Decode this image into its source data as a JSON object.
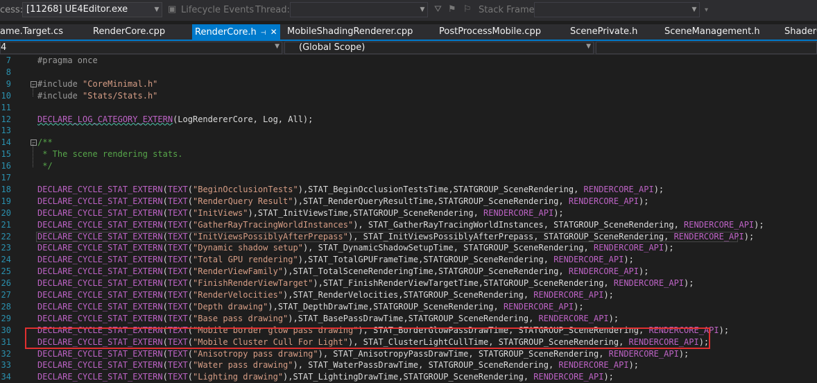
{
  "toolbar": {
    "process_label": "cess:",
    "process_value": "[11268] UE4Editor.exe",
    "lifecycle_label": "Lifecycle Events",
    "thread_label": "Thread:",
    "stack_frame_label": "Stack Frame:"
  },
  "tabs": [
    {
      "label": "ame.Target.cs",
      "active": false
    },
    {
      "label": "RenderCore.cpp",
      "active": false
    },
    {
      "label": "RenderCore.h",
      "active": true
    },
    {
      "label": "MobileShadingRenderer.cpp",
      "active": false
    },
    {
      "label": "PostProcessMobile.cpp",
      "active": false
    },
    {
      "label": "ScenePrivate.h",
      "active": false
    },
    {
      "label": "SceneManagement.h",
      "active": false
    },
    {
      "label": "ShaderC",
      "active": false
    }
  ],
  "navbar": {
    "project": "4",
    "scope": "(Global Scope)"
  },
  "colors": {
    "accent": "#007acc",
    "highlight_box": "#e03030",
    "line_number": "#2b91af",
    "string": "#d69d85",
    "macro": "#bd63c5",
    "comment": "#57a64a",
    "preprocessor": "#9b9b9b"
  },
  "code_lines": [
    {
      "n": "7",
      "tokens": [
        [
          "pre",
          "#pragma once"
        ]
      ]
    },
    {
      "n": "8",
      "tokens": []
    },
    {
      "n": "9",
      "fold": true,
      "tokens": [
        [
          "pre",
          "#include "
        ],
        [
          "str",
          "\"CoreMinimal.h\""
        ]
      ]
    },
    {
      "n": "10",
      "tokens": [
        [
          "pre",
          "#include "
        ],
        [
          "str",
          "\"Stats/Stats.h\""
        ]
      ]
    },
    {
      "n": "11",
      "tokens": []
    },
    {
      "n": "12",
      "tokens": [
        [
          "mac",
          "DECLARE_LOG_CATEGORY_EXTERN"
        ],
        [
          "txt",
          "(LogRendererCore, Log, All);"
        ]
      ]
    },
    {
      "n": "13",
      "tokens": []
    },
    {
      "n": "14",
      "fold": true,
      "tokens": [
        [
          "cmt",
          "/**"
        ]
      ]
    },
    {
      "n": "15",
      "tokens": [
        [
          "cmt",
          " * The scene rendering stats."
        ]
      ]
    },
    {
      "n": "16",
      "tokens": [
        [
          "cmt",
          " */"
        ]
      ]
    },
    {
      "n": "17",
      "tokens": []
    },
    {
      "n": "18",
      "tokens": [
        [
          "mac",
          "DECLARE_CYCLE_STAT_EXTERN"
        ],
        [
          "txt",
          "("
        ],
        [
          "mac",
          "TEXT"
        ],
        [
          "txt",
          "("
        ],
        [
          "str",
          "\"BeginOcclusionTests\""
        ],
        [
          "txt",
          "),STAT_BeginOcclusionTestsTime,STATGROUP_SceneRendering, "
        ],
        [
          "mac",
          "RENDERCORE_API"
        ],
        [
          "txt",
          ");"
        ]
      ]
    },
    {
      "n": "19",
      "tokens": [
        [
          "mac",
          "DECLARE_CYCLE_STAT_EXTERN"
        ],
        [
          "txt",
          "("
        ],
        [
          "mac",
          "TEXT"
        ],
        [
          "txt",
          "("
        ],
        [
          "str",
          "\"RenderQuery Result\""
        ],
        [
          "txt",
          "),STAT_RenderQueryResultTime,STATGROUP_SceneRendering, "
        ],
        [
          "mac",
          "RENDERCORE_API"
        ],
        [
          "txt",
          ");"
        ]
      ]
    },
    {
      "n": "20",
      "tokens": [
        [
          "mac",
          "DECLARE_CYCLE_STAT_EXTERN"
        ],
        [
          "txt",
          "("
        ],
        [
          "mac",
          "TEXT"
        ],
        [
          "txt",
          "("
        ],
        [
          "str",
          "\"InitViews\""
        ],
        [
          "txt",
          "),STAT_InitViewsTime,STATGROUP_SceneRendering, "
        ],
        [
          "mac",
          "RENDERCORE_API"
        ],
        [
          "txt",
          ");"
        ]
      ]
    },
    {
      "n": "21",
      "tokens": [
        [
          "mac",
          "DECLARE_CYCLE_STAT_EXTERN"
        ],
        [
          "txt",
          "("
        ],
        [
          "mac",
          "TEXT"
        ],
        [
          "txt",
          "("
        ],
        [
          "str",
          "\"GatherRayTracingWorldInstances\""
        ],
        [
          "txt",
          "), STAT_GatherRayTracingWorldInstances, STATGROUP_SceneRendering, "
        ],
        [
          "mac",
          "RENDERCORE_API"
        ],
        [
          "txt",
          ");"
        ]
      ]
    },
    {
      "n": "22",
      "current": true,
      "tokens": [
        [
          "mac",
          "DECLARE_CYCLE_STAT_EXTERN"
        ],
        [
          "txt",
          "("
        ],
        [
          "mac",
          "TEXT"
        ],
        [
          "txt",
          "("
        ],
        [
          "str",
          "\"InitViewsPossiblyAfterPrepass\""
        ],
        [
          "txt",
          "), STAT_InitViewsPossiblyAfterPrepass, STATGROUP_SceneRendering, "
        ],
        [
          "mac",
          "RENDERCORE_API"
        ],
        [
          "txt",
          ");"
        ]
      ]
    },
    {
      "n": "23",
      "tokens": [
        [
          "mac",
          "DECLARE_CYCLE_STAT_EXTERN"
        ],
        [
          "txt",
          "("
        ],
        [
          "mac",
          "TEXT"
        ],
        [
          "txt",
          "("
        ],
        [
          "str",
          "\"Dynamic shadow setup\""
        ],
        [
          "txt",
          "), STAT_DynamicShadowSetupTime, STATGROUP_SceneRendering, "
        ],
        [
          "mac",
          "RENDERCORE_API"
        ],
        [
          "txt",
          ");"
        ]
      ]
    },
    {
      "n": "24",
      "tokens": [
        [
          "mac",
          "DECLARE_CYCLE_STAT_EXTERN"
        ],
        [
          "txt",
          "("
        ],
        [
          "mac",
          "TEXT"
        ],
        [
          "txt",
          "("
        ],
        [
          "str",
          "\"Total GPU rendering\""
        ],
        [
          "txt",
          "),STAT_TotalGPUFrameTime,STATGROUP_SceneRendering, "
        ],
        [
          "mac",
          "RENDERCORE_API"
        ],
        [
          "txt",
          ");"
        ]
      ]
    },
    {
      "n": "25",
      "tokens": [
        [
          "mac",
          "DECLARE_CYCLE_STAT_EXTERN"
        ],
        [
          "txt",
          "("
        ],
        [
          "mac",
          "TEXT"
        ],
        [
          "txt",
          "("
        ],
        [
          "str",
          "\"RenderViewFamily\""
        ],
        [
          "txt",
          "),STAT_TotalSceneRenderingTime,STATGROUP_SceneRendering, "
        ],
        [
          "mac",
          "RENDERCORE_API"
        ],
        [
          "txt",
          ");"
        ]
      ]
    },
    {
      "n": "26",
      "tokens": [
        [
          "mac",
          "DECLARE_CYCLE_STAT_EXTERN"
        ],
        [
          "txt",
          "("
        ],
        [
          "mac",
          "TEXT"
        ],
        [
          "txt",
          "("
        ],
        [
          "str",
          "\"FinishRenderViewTarget\""
        ],
        [
          "txt",
          "),STAT_FinishRenderViewTargetTime,STATGROUP_SceneRendering, "
        ],
        [
          "mac",
          "RENDERCORE_API"
        ],
        [
          "txt",
          ");"
        ]
      ]
    },
    {
      "n": "27",
      "tokens": [
        [
          "mac",
          "DECLARE_CYCLE_STAT_EXTERN"
        ],
        [
          "txt",
          "("
        ],
        [
          "mac",
          "TEXT"
        ],
        [
          "txt",
          "("
        ],
        [
          "str",
          "\"RenderVelocities\""
        ],
        [
          "txt",
          "),STAT_RenderVelocities,STATGROUP_SceneRendering, "
        ],
        [
          "mac",
          "RENDERCORE_API"
        ],
        [
          "txt",
          ");"
        ]
      ]
    },
    {
      "n": "28",
      "tokens": [
        [
          "mac",
          "DECLARE_CYCLE_STAT_EXTERN"
        ],
        [
          "txt",
          "("
        ],
        [
          "mac",
          "TEXT"
        ],
        [
          "txt",
          "("
        ],
        [
          "str",
          "\"Depth drawing\""
        ],
        [
          "txt",
          "),STAT_DepthDrawTime,STATGROUP_SceneRendering, "
        ],
        [
          "mac",
          "RENDERCORE_API"
        ],
        [
          "txt",
          ");"
        ]
      ]
    },
    {
      "n": "29",
      "tokens": [
        [
          "mac",
          "DECLARE_CYCLE_STAT_EXTERN"
        ],
        [
          "txt",
          "("
        ],
        [
          "mac",
          "TEXT"
        ],
        [
          "txt",
          "("
        ],
        [
          "str",
          "\"Base pass drawing\""
        ],
        [
          "txt",
          "),STAT_BasePassDrawTime,STATGROUP_SceneRendering, "
        ],
        [
          "mac",
          "RENDERCORE_API"
        ],
        [
          "txt",
          ");"
        ]
      ]
    },
    {
      "n": "30",
      "tokens": [
        [
          "mac",
          "DECLARE_CYCLE_STAT_EXTERN"
        ],
        [
          "txt",
          "("
        ],
        [
          "mac",
          "TEXT"
        ],
        [
          "txt",
          "("
        ],
        [
          "str",
          "\"Mobile border glow pass drawing\""
        ],
        [
          "txt",
          "), STAT_BorderGlowPassDrawTime, STATGROUP_SceneRendering, "
        ],
        [
          "mac",
          "RENDERCORE_API"
        ],
        [
          "txt",
          ");"
        ]
      ]
    },
    {
      "n": "31",
      "tokens": [
        [
          "mac",
          "DECLARE_CYCLE_STAT_EXTERN"
        ],
        [
          "txt",
          "("
        ],
        [
          "mac",
          "TEXT"
        ],
        [
          "txt",
          "("
        ],
        [
          "str",
          "\"Mobile Cluster Cull For Light\""
        ],
        [
          "txt",
          "), STAT_ClusterLightCullTime, STATGROUP_SceneRendering, "
        ],
        [
          "mac",
          "RENDERCORE_API"
        ],
        [
          "txt",
          ");"
        ]
      ]
    },
    {
      "n": "32",
      "tokens": [
        [
          "mac",
          "DECLARE_CYCLE_STAT_EXTERN"
        ],
        [
          "txt",
          "("
        ],
        [
          "mac",
          "TEXT"
        ],
        [
          "txt",
          "("
        ],
        [
          "str",
          "\"Anisotropy pass drawing\""
        ],
        [
          "txt",
          "), STAT_AnisotropyPassDrawTime, STATGROUP_SceneRendering, "
        ],
        [
          "mac",
          "RENDERCORE_API"
        ],
        [
          "txt",
          ");"
        ]
      ]
    },
    {
      "n": "33",
      "tokens": [
        [
          "mac",
          "DECLARE_CYCLE_STAT_EXTERN"
        ],
        [
          "txt",
          "("
        ],
        [
          "mac",
          "TEXT"
        ],
        [
          "txt",
          "("
        ],
        [
          "str",
          "\"Water pass drawing\""
        ],
        [
          "txt",
          "), STAT_WaterPassDrawTime, STATGROUP_SceneRendering, "
        ],
        [
          "mac",
          "RENDERCORE_API"
        ],
        [
          "txt",
          ");"
        ]
      ]
    },
    {
      "n": "34",
      "tokens": [
        [
          "mac",
          "DECLARE_CYCLE_STAT_EXTERN"
        ],
        [
          "txt",
          "("
        ],
        [
          "mac",
          "TEXT"
        ],
        [
          "txt",
          "("
        ],
        [
          "str",
          "\"Lighting drawing\""
        ],
        [
          "txt",
          "),STAT_LightingDrawTime,STATGROUP_SceneRendering, "
        ],
        [
          "mac",
          "RENDERCORE_API"
        ],
        [
          "txt",
          ");"
        ]
      ]
    }
  ]
}
